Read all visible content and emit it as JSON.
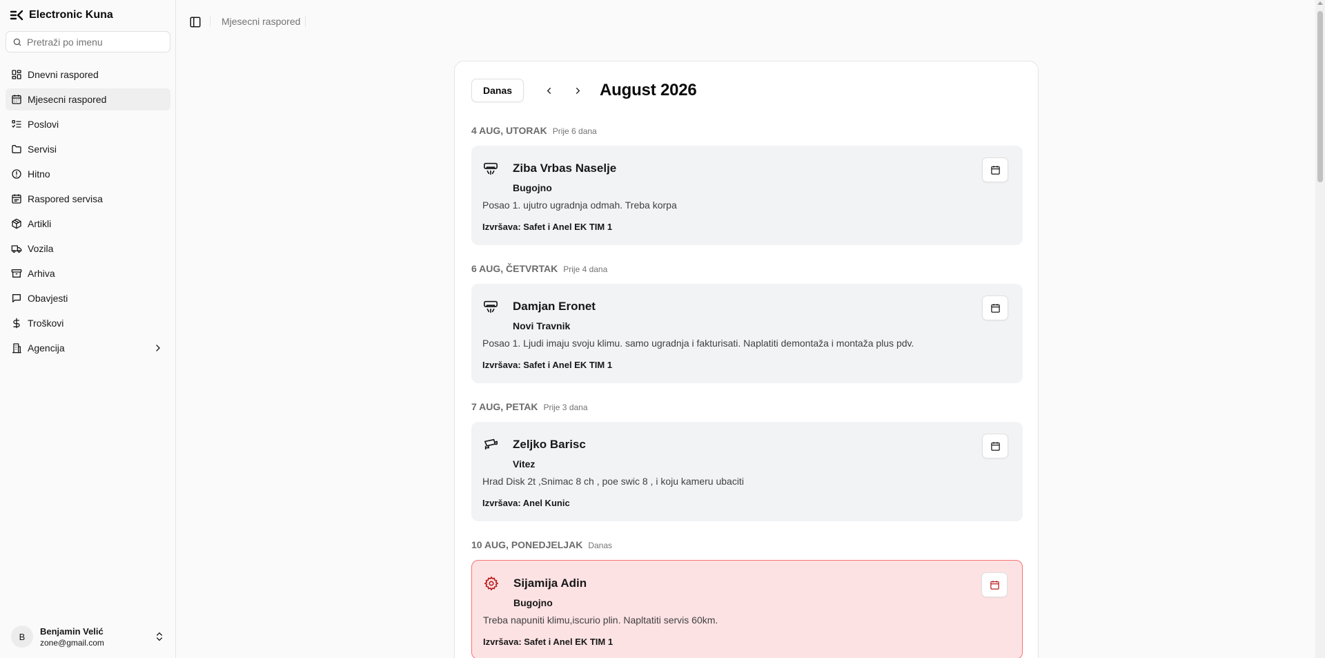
{
  "app": {
    "name": "Electronic Kuna"
  },
  "search": {
    "placeholder": "Pretraži po imenu"
  },
  "sidebar": {
    "items": [
      {
        "label": "Dnevni raspored",
        "icon": "dashboard-icon",
        "active": false
      },
      {
        "label": "Mjesecni raspored",
        "icon": "calendar-icon",
        "active": true
      },
      {
        "label": "Poslovi",
        "icon": "list-check-icon",
        "active": false
      },
      {
        "label": "Servisi",
        "icon": "folder-icon",
        "active": false
      },
      {
        "label": "Hitno",
        "icon": "alert-circle-icon",
        "active": false
      },
      {
        "label": "Raspored servisa",
        "icon": "calendar-days-icon",
        "active": false
      },
      {
        "label": "Artikli",
        "icon": "package-icon",
        "active": false
      },
      {
        "label": "Vozila",
        "icon": "truck-icon",
        "active": false
      },
      {
        "label": "Arhiva",
        "icon": "archive-icon",
        "active": false
      },
      {
        "label": "Obavjesti",
        "icon": "message-icon",
        "active": false
      },
      {
        "label": "Troškovi",
        "icon": "dollar-icon",
        "active": false
      },
      {
        "label": "Agencija",
        "icon": "building-icon",
        "active": false
      }
    ]
  },
  "user": {
    "initial": "B",
    "name": "Benjamin Velić",
    "email": "zone@gmail.com"
  },
  "breadcrumb": {
    "current": "Mjesecni raspored"
  },
  "calendar": {
    "today_label": "Danas",
    "month_title": "August 2026",
    "sections": [
      {
        "date": "4 AUG, UTORAK",
        "relative": "Prije 6 dana",
        "card": {
          "icon": "air-conditioner-icon",
          "title": "Ziba Vrbas Naselje",
          "city": "Bugojno",
          "description": "Posao 1. ujutro ugradnja odmah. Treba korpa",
          "assignee": "Izvršava: Safet i Anel EK TIM 1",
          "urgent": false
        }
      },
      {
        "date": "6 AUG, ČETVRTAK",
        "relative": "Prije 4 dana",
        "card": {
          "icon": "air-conditioner-icon",
          "title": "Damjan Eronet",
          "city": "Novi Travnik",
          "description": "Posao 1. Ljudi imaju svoju klimu. samo ugradnja i fakturisati. Naplatiti demontaža i montaža plus pdv.",
          "assignee": "Izvršava: Safet i Anel EK TIM 1",
          "urgent": false
        }
      },
      {
        "date": "7 AUG, PETAK",
        "relative": "Prije 3 dana",
        "card": {
          "icon": "cctv-camera-icon",
          "title": "Zeljko Barisc",
          "city": "Vitez",
          "description": "Hrad Disk 2t ,Snimac 8 ch , poe swic 8 , i koju kameru ubaciti",
          "assignee": "Izvršava: Anel Kunic",
          "urgent": false
        }
      },
      {
        "date": "10 AUG, PONEDJELJAK",
        "relative": "Danas",
        "card": {
          "icon": "gear-icon",
          "title": "Sijamija Adin",
          "city": "Bugojno",
          "description": "Treba napuniti klimu,iscurio plin. Napltatiti servis 60km.",
          "assignee": "Izvršava: Safet i Anel EK TIM 1",
          "urgent": true
        }
      }
    ]
  },
  "colors": {
    "urgent_bg": "#fde2e4",
    "urgent_border": "#f87171",
    "card_bg": "#f2f3f5",
    "accent_icon_urgent": "#b91c1c"
  }
}
